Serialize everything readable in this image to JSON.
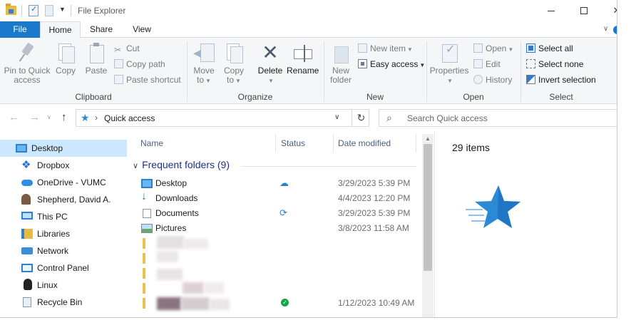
{
  "window": {
    "title": "File Explorer",
    "controls": {
      "minimize": "",
      "maximize": "",
      "close": "✕"
    }
  },
  "ribbon_tabs": [
    "File",
    "Home",
    "Share",
    "View"
  ],
  "ribbon": {
    "clipboard": {
      "label": "Clipboard",
      "pin_to_quick_access": [
        "Pin to Quick",
        "access"
      ],
      "copy": "Copy",
      "paste": "Paste",
      "cut": "Cut",
      "copy_path": "Copy path",
      "paste_shortcut": "Paste shortcut"
    },
    "organize": {
      "label": "Organize",
      "move_to": [
        "Move",
        "to"
      ],
      "copy_to": [
        "Copy",
        "to"
      ],
      "delete": "Delete",
      "rename": "Rename"
    },
    "new": {
      "label": "New",
      "new_folder": [
        "New",
        "folder"
      ],
      "new_item": "New item",
      "easy_access": "Easy access"
    },
    "open": {
      "label": "Open",
      "properties": "Properties",
      "open": "Open",
      "edit": "Edit",
      "history": "History"
    },
    "select": {
      "label": "Select",
      "select_all": "Select all",
      "select_none": "Select none",
      "invert_selection": "Invert selection"
    }
  },
  "address": {
    "path": "Quick access",
    "search_placeholder": "Search Quick access"
  },
  "nav_pane": [
    {
      "label": "Desktop",
      "icon": "desktop-icon",
      "selected": true
    },
    {
      "label": "Dropbox",
      "icon": "dropbox-icon"
    },
    {
      "label": "OneDrive - VUMC",
      "icon": "onedrive-icon"
    },
    {
      "label": "Shepherd, David A.",
      "icon": "user-icon"
    },
    {
      "label": "This PC",
      "icon": "pc-icon"
    },
    {
      "label": "Libraries",
      "icon": "libraries-icon"
    },
    {
      "label": "Network",
      "icon": "network-icon"
    },
    {
      "label": "Control Panel",
      "icon": "control-panel-icon"
    },
    {
      "label": "Linux",
      "icon": "linux-icon"
    },
    {
      "label": "Recycle Bin",
      "icon": "recycle-bin-icon"
    }
  ],
  "columns": {
    "name": "Name",
    "status": "Status",
    "date_modified": "Date modified"
  },
  "group": {
    "label": "Frequent folders (9)"
  },
  "rows": [
    {
      "name": "Desktop",
      "status": "cloud-icon",
      "date": "3/29/2023 5:39 PM"
    },
    {
      "name": "Downloads",
      "status": "",
      "date": "4/4/2023 12:20 PM"
    },
    {
      "name": "Documents",
      "status": "sync-icon",
      "date": "3/29/2023 5:39 PM"
    },
    {
      "name": "Pictures",
      "status": "",
      "date": "3/8/2023 11:58 AM"
    },
    {
      "name": "",
      "status": "",
      "date": ""
    },
    {
      "name": "",
      "status": "",
      "date": ""
    },
    {
      "name": "",
      "status": "",
      "date": ""
    },
    {
      "name": "",
      "status": "",
      "date": ""
    },
    {
      "name": "",
      "status": "check-icon",
      "date": "1/12/2023 10:49 AM"
    }
  ],
  "details": {
    "count": "29 items"
  },
  "colors": {
    "accent": "#1979ca",
    "selection": "#cce8ff",
    "group_header": "#1e3287",
    "quick_access_star": "#2b8ad6"
  }
}
